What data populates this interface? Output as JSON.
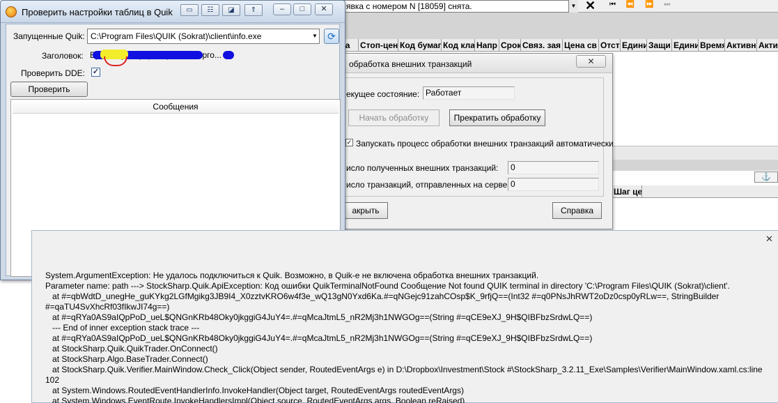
{
  "quik_main": {
    "status_text": "явка с номером N [18059] снята.",
    "columns": [
      "за",
      "Стоп-цен",
      "Код бумаг",
      "Код кла",
      "Напр",
      "Срок",
      "Связ. зая",
      "Цена св",
      "Отст",
      "Едини",
      "Защи",
      "Едини",
      "Время",
      "Активн",
      "Акти"
    ],
    "bottom_column": "Шаг це",
    "nav_glyphs": "⏮ ⏪",
    "nav_glyphs_dim": "⏩ ⏭",
    "close_glyph": "✕",
    "anchor_glyph": "⚓"
  },
  "verifier": {
    "title": "Проверить настройки таблиц в Quik",
    "quik_label": "Запущенные Quik:",
    "quik_path": "C:\\Program Files\\QUIK (Sokrat)\\client\\info.exe",
    "header_label": "Заголовок:",
    "header_value": "                                          Бр               UID:      ] Информационно-торго...",
    "dde_label": "Проверить DDE:",
    "dde_checked": "✓",
    "check_button": "Проверить",
    "messages_header": "Сообщения"
  },
  "ext_dialog": {
    "title": "обработка внешних транзакций",
    "state_label": "екущее состояние:",
    "state_value": "Работает",
    "start_button": "Начать обработку",
    "stop_button": "Прекратить обработку",
    "auto_label": "Запускать процесс обработки внешних транзакций автоматически",
    "received_label": "исло полученных внешних транзакций:",
    "received_value": "0",
    "sent_label": "исло транзакций, отправленных на сервер:",
    "sent_value": "0",
    "close_button": "акрыть",
    "help_button": "Справка"
  },
  "error_window": {
    "text": "System.ArgumentException: Не удалось подключиться к Quik. Возможно, в Quik-е не включена обработка внешних транзакций.\nParameter name: path ---> StockSharp.Quik.ApiException: Код ошибки QuikTerminalNotFound Сообщение Not found QUIK terminal in directory 'C:\\Program Files\\QUIK (Sokrat)\\client'.\n   at #=qbWdtD_unegHe_guKYkg2LGfMgikg3JB9I4_X0zztvKRO6w4f3e_wQ13gN0Yxd6Ka.#=qNGejc91zahCOsp$K_9rfjQ==(Int32 #=q0PNsJhRWT2oDz0csp0yRLw==, StringBuilder #=qaTU4SvXhcRf03fIkwJI74g==)\n   at #=qRYa0AS9aIQpPoD_ueL$QNGnKRb48Oky0jkggiG4JuY4=.#=qMcaJtmL5_nR2Mj3h1NWGOg==(String #=qCE9eXJ_9H$QIBFbzSrdwLQ==)\n   --- End of inner exception stack trace ---\n   at #=qRYa0AS9aIQpPoD_ueL$QNGnKRb48Oky0jkggiG4JuY4=.#=qMcaJtmL5_nR2Mj3h1NWGOg==(String #=qCE9eXJ_9H$QIBFbzSrdwLQ==)\n   at StockSharp.Quik.QuikTrader.OnConnect()\n   at StockSharp.Algo.BaseTrader.Connect()\n   at StockSharp.Quik.Verifier.MainWindow.Check_Click(Object sender, RoutedEventArgs e) in D:\\Dropbox\\Investment\\Stock #\\StockSharp_3.2.11_Exe\\Samples\\Verifier\\MainWindow.xaml.cs:line 102\n   at System.Windows.RoutedEventHandlerInfo.InvokeHandler(Object target, RoutedEventArgs routedEventArgs)\n   at System.Windows.EventRoute.InvokeHandlersImpl(Object source, RoutedEventArgs args, Boolean reRaised)\n   at System.Windows.UIElement.RaiseEventImpl(DependencyObject sender, RoutedEventArgs args)",
    "close_glyph": "✕"
  }
}
